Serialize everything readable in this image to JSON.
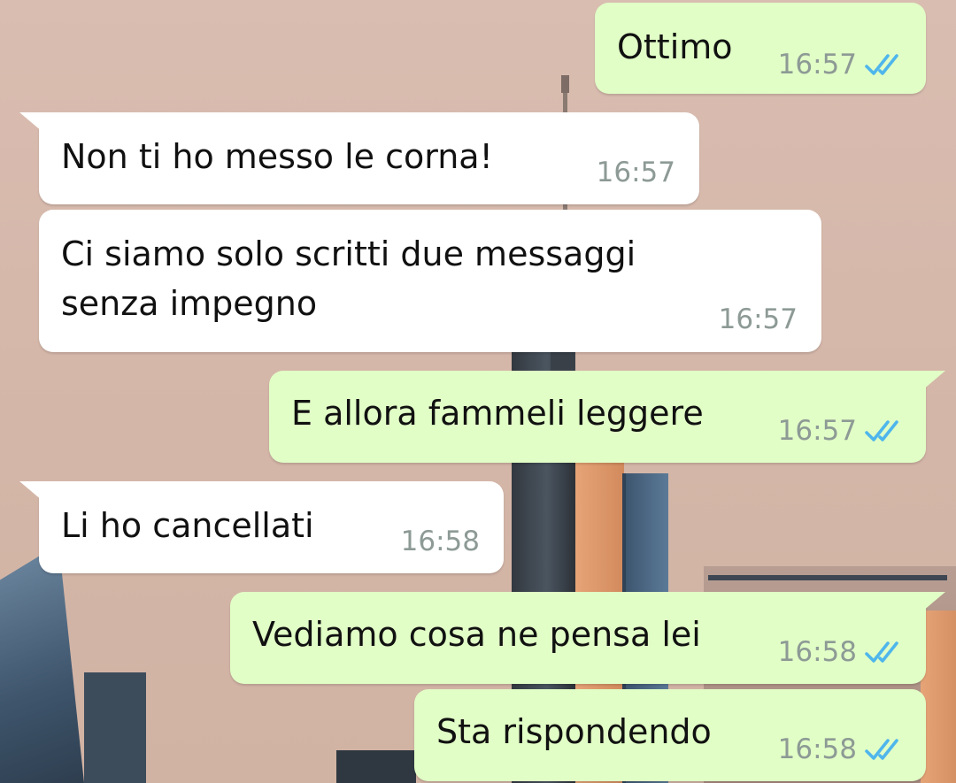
{
  "chat": {
    "messages": [
      {
        "direction": "out",
        "text": "Ottimo",
        "time": "16:57",
        "status": "read"
      },
      {
        "direction": "in",
        "text": "Non ti ho messo le corna!",
        "time": "16:57"
      },
      {
        "direction": "in",
        "text_lines": [
          "Ci siamo solo scritti due messaggi",
          "senza impegno"
        ],
        "time": "16:57"
      },
      {
        "direction": "out",
        "text": "E allora fammeli leggere",
        "time": "16:57",
        "status": "read"
      },
      {
        "direction": "in",
        "text": "Li ho cancellati",
        "time": "16:58"
      },
      {
        "direction": "out",
        "text": "Vediamo cosa ne pensa lei",
        "time": "16:58",
        "status": "read"
      },
      {
        "direction": "out",
        "text": "Sta rispondendo",
        "time": "16:58",
        "status": "read"
      }
    ]
  },
  "colors": {
    "outgoing_bubble": "#e1fec6",
    "incoming_bubble": "#ffffff",
    "read_ticks": "#4fb6ec",
    "timestamp": "#8d9a95",
    "message_text": "#111111"
  },
  "icons": {
    "read_status": "double-check-icon"
  }
}
